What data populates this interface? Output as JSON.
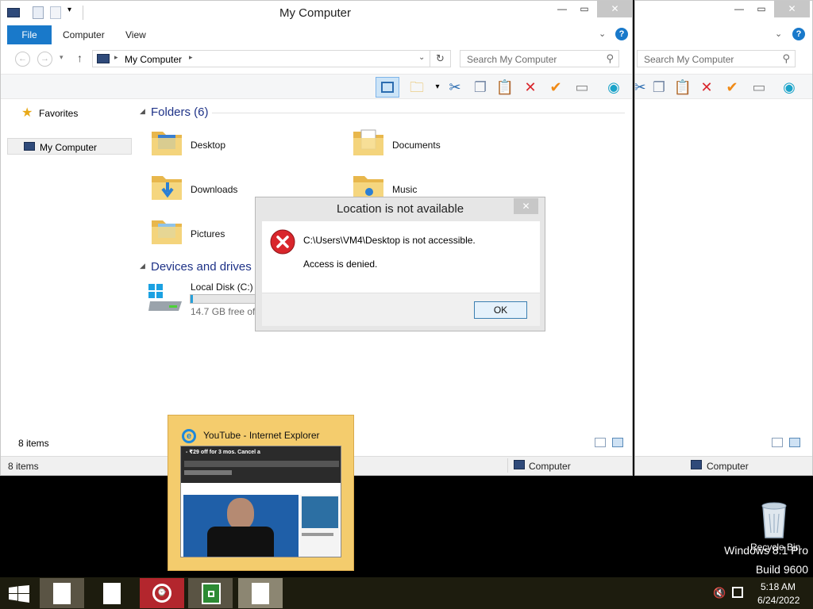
{
  "main_window": {
    "title": "My Computer",
    "tabs": [
      "File",
      "Computer",
      "View"
    ],
    "address": "My Computer",
    "search_placeholder": "Search My Computer",
    "nav": {
      "favorites": "Favorites",
      "my_computer": "My Computer"
    },
    "folders_header": "Folders (6)",
    "folders": [
      "Desktop",
      "Documents",
      "Downloads",
      "Music",
      "Pictures"
    ],
    "drives_header": "Devices and drives (",
    "drive": {
      "name": "Local Disk (C:)",
      "free": "14.7 GB free of 1",
      "usage_fraction": 0.03
    },
    "item_count_inner": "8 items",
    "status_left": "8 items",
    "status_right": "Computer"
  },
  "back_window": {
    "search_placeholder": "Search My Computer",
    "status_right": "Computer"
  },
  "dialog": {
    "title": "Location is not available",
    "message": "C:\\Users\\VM4\\Desktop is not accessible.",
    "detail": "Access is denied.",
    "ok_label": "OK"
  },
  "thumbnail": {
    "title": "YouTube - Internet Explorer",
    "banner_text": "- ₹29 off  for 3 mos. Cancel a"
  },
  "desktop": {
    "recycle_bin": "Recycle Bin",
    "watermark_line1": "Windows 8.1 Pro",
    "watermark_line2": "Build 9600"
  },
  "taskbar": {
    "time": "5:18 AM",
    "date": "6/24/2022"
  },
  "colors": {
    "accent": "#1979ca",
    "taskbar": "#1d1c0e",
    "thumbnail_bg": "#f4cc6d",
    "error_red": "#d9262c",
    "alarm_red": "#b3262d",
    "store_green": "#2d8b34"
  }
}
